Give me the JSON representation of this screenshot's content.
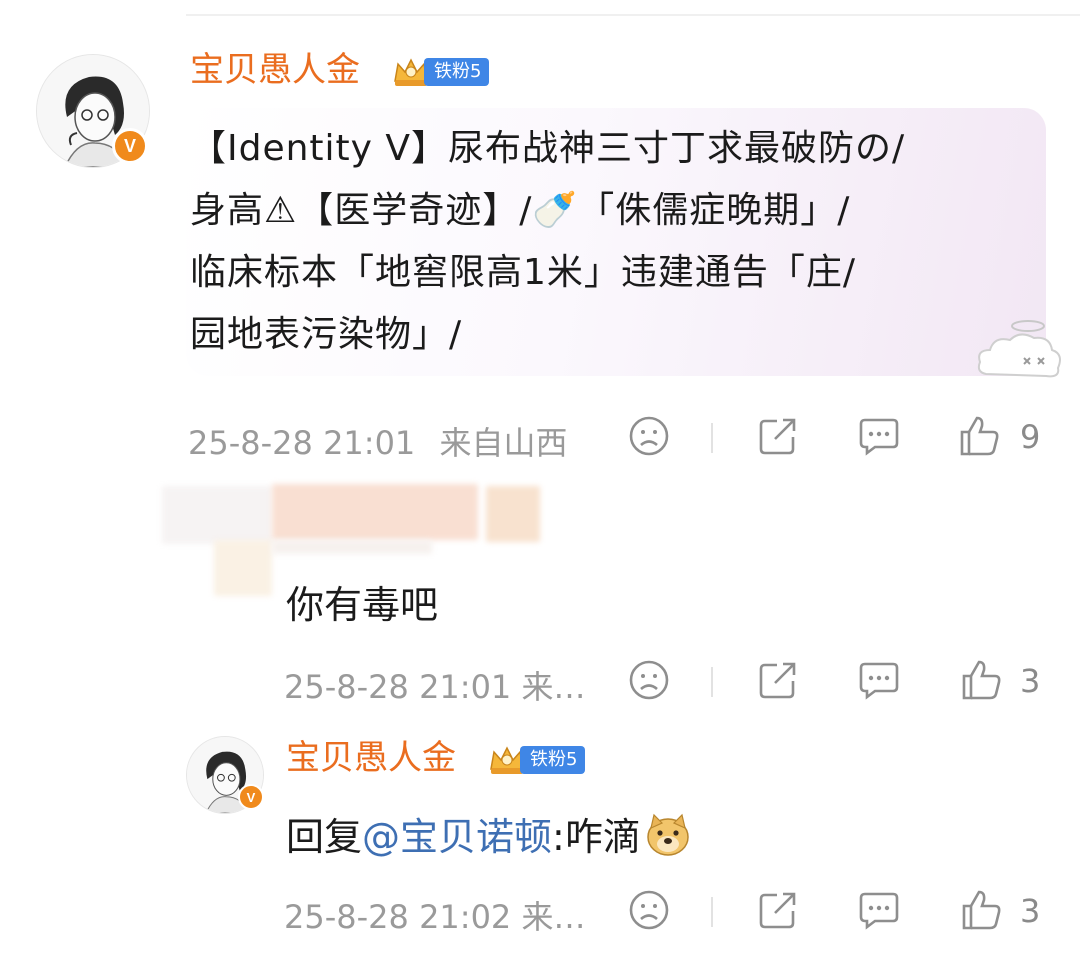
{
  "comment": {
    "username": "宝贝愚人金",
    "fan_badge": "铁粉5",
    "verified_mark": "V",
    "lines": [
      "【Identity V】尿布战神三寸丁求最破防の/",
      "身高⚠【医学奇迹】/🍼「侏儒症晚期」/",
      "临床标本「地窖限高1米」违建通告「庄/",
      "园地表污染物」/"
    ],
    "timestamp": "25-8-28 21:01",
    "location": "来自山西",
    "like_count": "9"
  },
  "reply1": {
    "text": "你有毒吧",
    "meta": "25-8-28 21:01  来…",
    "like_count": "3"
  },
  "reply2": {
    "username": "宝贝愚人金",
    "fan_badge": "铁粉5",
    "verified_mark": "V",
    "prefix": "回复",
    "mention": "@宝贝诺顿",
    "suffix": ":咋滴",
    "emoji": "doge-emoji",
    "meta": "25-8-28 21:02  来…",
    "like_count": "3"
  },
  "icons": [
    "sad-face-icon",
    "share-icon",
    "comment-icon",
    "thumbs-up-icon",
    "crown-icon",
    "cloud-sticker-icon"
  ],
  "colors": {
    "username": "#ea6d1f",
    "fan_badge": "#3f86e6",
    "mention": "#3e6fb3",
    "meta_text": "#9a9a9a",
    "verified": "#f08a1c"
  }
}
